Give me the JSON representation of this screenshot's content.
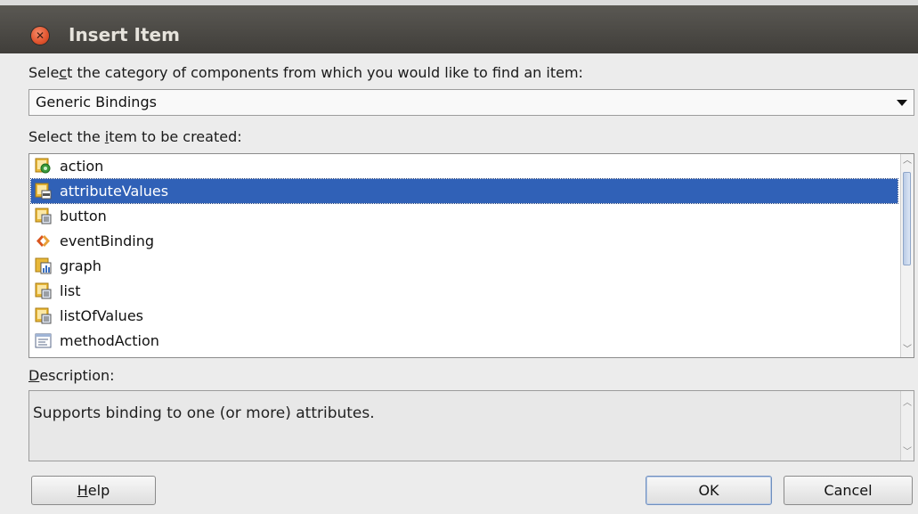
{
  "dialog": {
    "title": "Insert Item",
    "close_glyph": "✕"
  },
  "category": {
    "label_pre": "Sele",
    "label_u": "c",
    "label_post": "t the category of components from which you would like to find an item:",
    "selected": "Generic Bindings"
  },
  "items_section": {
    "label_pre": "Select the ",
    "label_u": "i",
    "label_post": "tem to be created:",
    "items": [
      {
        "label": "action",
        "icon": "action-icon"
      },
      {
        "label": "attributeValues",
        "icon": "attribute-values-icon",
        "selected": true
      },
      {
        "label": "button",
        "icon": "button-icon"
      },
      {
        "label": "eventBinding",
        "icon": "event-binding-icon"
      },
      {
        "label": "graph",
        "icon": "graph-icon"
      },
      {
        "label": "list",
        "icon": "list-icon"
      },
      {
        "label": "listOfValues",
        "icon": "list-of-values-icon"
      },
      {
        "label": "methodAction",
        "icon": "method-action-icon"
      }
    ]
  },
  "description": {
    "label_u": "D",
    "label_post": "escription:",
    "text": "Supports binding to one (or more) attributes."
  },
  "buttons": {
    "help_u": "H",
    "help_rest": "elp",
    "ok": "OK",
    "cancel": "Cancel"
  },
  "colors": {
    "selection": "#3061b7",
    "titlebar": "#4a4844",
    "close": "#e0532d"
  }
}
